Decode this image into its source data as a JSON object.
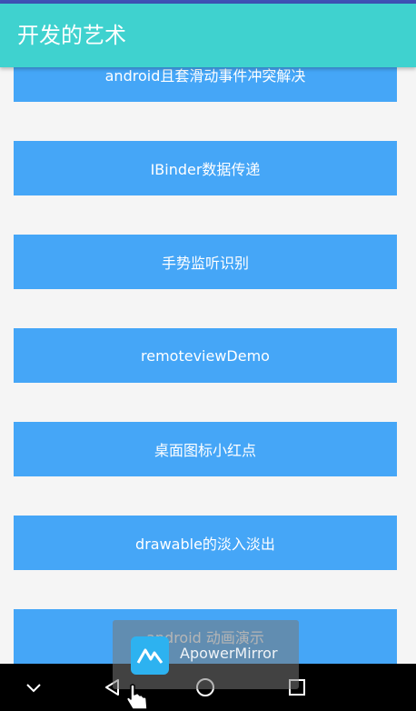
{
  "app": {
    "title": "开发的艺术",
    "colors": {
      "appbar": "#3fd2cf",
      "button": "#45a6f7",
      "statusbar": "#3f51b5"
    }
  },
  "list": {
    "items": [
      "android且套滑动事件冲突解决",
      "IBinder数据传递",
      "手势监听识别",
      "remoteviewDemo",
      "桌面图标小红点",
      "drawable的淡入淡出",
      "android 动画演示"
    ]
  },
  "overlay": {
    "label": "ApowerMirror",
    "logo_icon": "apowermirror-logo-icon"
  },
  "navbar": {
    "icons": [
      "chevron-down-icon",
      "back-triangle-icon",
      "home-circle-icon",
      "recents-square-icon"
    ]
  }
}
